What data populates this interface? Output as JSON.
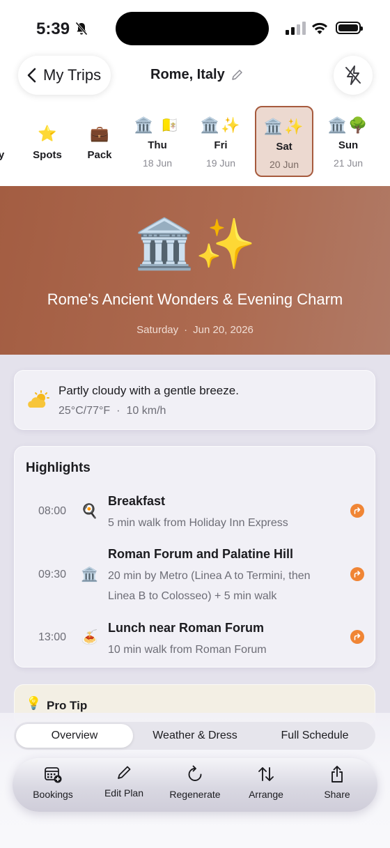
{
  "status": {
    "time": "5:39"
  },
  "header": {
    "back_label": "My Trips",
    "title": "Rome, Italy"
  },
  "day_strip": {
    "partial_label": "y",
    "spots": {
      "icon": "⭐",
      "label": "Spots"
    },
    "pack": {
      "icon": "💼",
      "label": "Pack"
    },
    "days": [
      {
        "emoji": "🏛️ 🇻🇦",
        "name": "Thu",
        "date": "18 Jun",
        "selected": false
      },
      {
        "emoji": "🏛️✨",
        "name": "Fri",
        "date": "19 Jun",
        "selected": false
      },
      {
        "emoji": "🏛️✨",
        "name": "Sat",
        "date": "20 Jun",
        "selected": true
      },
      {
        "emoji": "🏛️🌳",
        "name": "Sun",
        "date": "21 Jun",
        "selected": false
      }
    ]
  },
  "hero": {
    "emoji": "🏛️✨",
    "title": "Rome's Ancient Wonders & Evening Charm",
    "weekday": "Saturday",
    "date": "Jun 20, 2026"
  },
  "weather": {
    "description": "Partly cloudy with a gentle breeze.",
    "temperature": "25°C/77°F",
    "wind": "10 km/h"
  },
  "highlights": {
    "title": "Highlights",
    "items": [
      {
        "time": "08:00",
        "icon": "🍳",
        "name": "Breakfast",
        "desc": "5 min walk from Holiday Inn Express"
      },
      {
        "time": "09:30",
        "icon": "🏛️",
        "name": "Roman Forum and Palatine Hill",
        "desc": "20 min by Metro (Linea A to Termini, then Linea B to Colosseo) + 5 min walk"
      },
      {
        "time": "13:00",
        "icon": "🍝",
        "name": "Lunch near Roman Forum",
        "desc": "10 min walk from Roman Forum"
      }
    ]
  },
  "tip": {
    "icon": "💡",
    "label": "Pro Tip"
  },
  "segments": {
    "overview": "Overview",
    "weather_dress": "Weather & Dress",
    "full_schedule": "Full Schedule"
  },
  "toolbar": {
    "bookings": "Bookings",
    "edit_plan": "Edit Plan",
    "regenerate": "Regenerate",
    "arrange": "Arrange",
    "share": "Share"
  },
  "colors": {
    "accent": "#a35d42",
    "action_orange": "#f08535"
  }
}
